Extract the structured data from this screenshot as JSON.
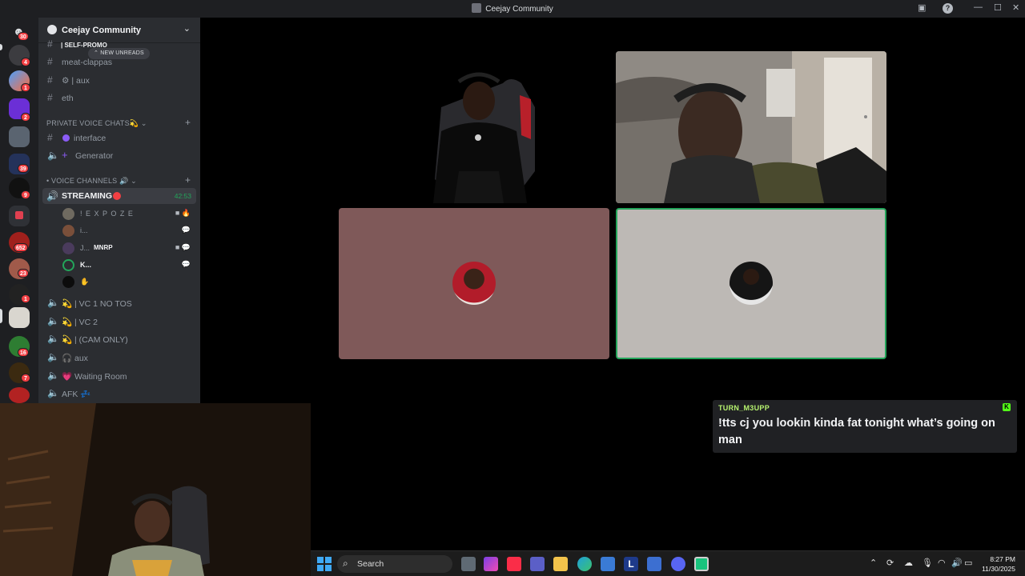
{
  "window": {
    "title": "Ceejay Community"
  },
  "server_rail": {
    "badges": [
      "30",
      "4",
      "1",
      "2",
      "39",
      "9",
      "652",
      "23",
      "1",
      "16",
      "7"
    ]
  },
  "guild": {
    "name": "Ceejay Community"
  },
  "channels": {
    "new_unreads": "⌃ NEW UNREADS",
    "self_promo": "| SELF-PROMO",
    "text": [
      {
        "label": "meat-clappas"
      },
      {
        "label": "⚙ | aux"
      },
      {
        "label": "eth"
      }
    ],
    "private_category": "PRIVATE VOICE CHATS💫 ⌄",
    "private": [
      {
        "label": "interface"
      },
      {
        "label": "Generator"
      }
    ],
    "voice_category": "• VOICE CHANNELS 🔊 ⌄",
    "streaming": {
      "label": "STREAMING",
      "time": "42:53"
    },
    "voice_users": [
      {
        "name": "! E X P O Z E",
        "indicator": "■ 🔥"
      },
      {
        "name": "i...",
        "indicator": "💬"
      },
      {
        "name": "J...",
        "tag": "MNRP",
        "indicator": "■ 💬"
      },
      {
        "name": "K...",
        "indicator": "💬"
      },
      {
        "name": "✋",
        "indicator": ""
      }
    ],
    "voice": [
      {
        "label": "💫 | VC 1 NO TOS"
      },
      {
        "label": "💫 | VC 2"
      },
      {
        "label": "💫 | (CAM ONLY)"
      },
      {
        "label": "🎧 aux"
      },
      {
        "label": "💗 Waiting Room"
      },
      {
        "label": "AFK 💤"
      }
    ]
  },
  "chat_overlay": {
    "username": "TURN_M3UPP",
    "message": "!tts cj you lookin kinda fat tonight what’s going on man",
    "kick_badge": "K"
  },
  "taskbar": {
    "search_placeholder": "Search",
    "time": "8:27 PM",
    "date": "11/30/2025"
  },
  "colors": {
    "accent_green": "#23a55a",
    "live_red": "#f23f43",
    "chat_user": "#b6f26f"
  }
}
